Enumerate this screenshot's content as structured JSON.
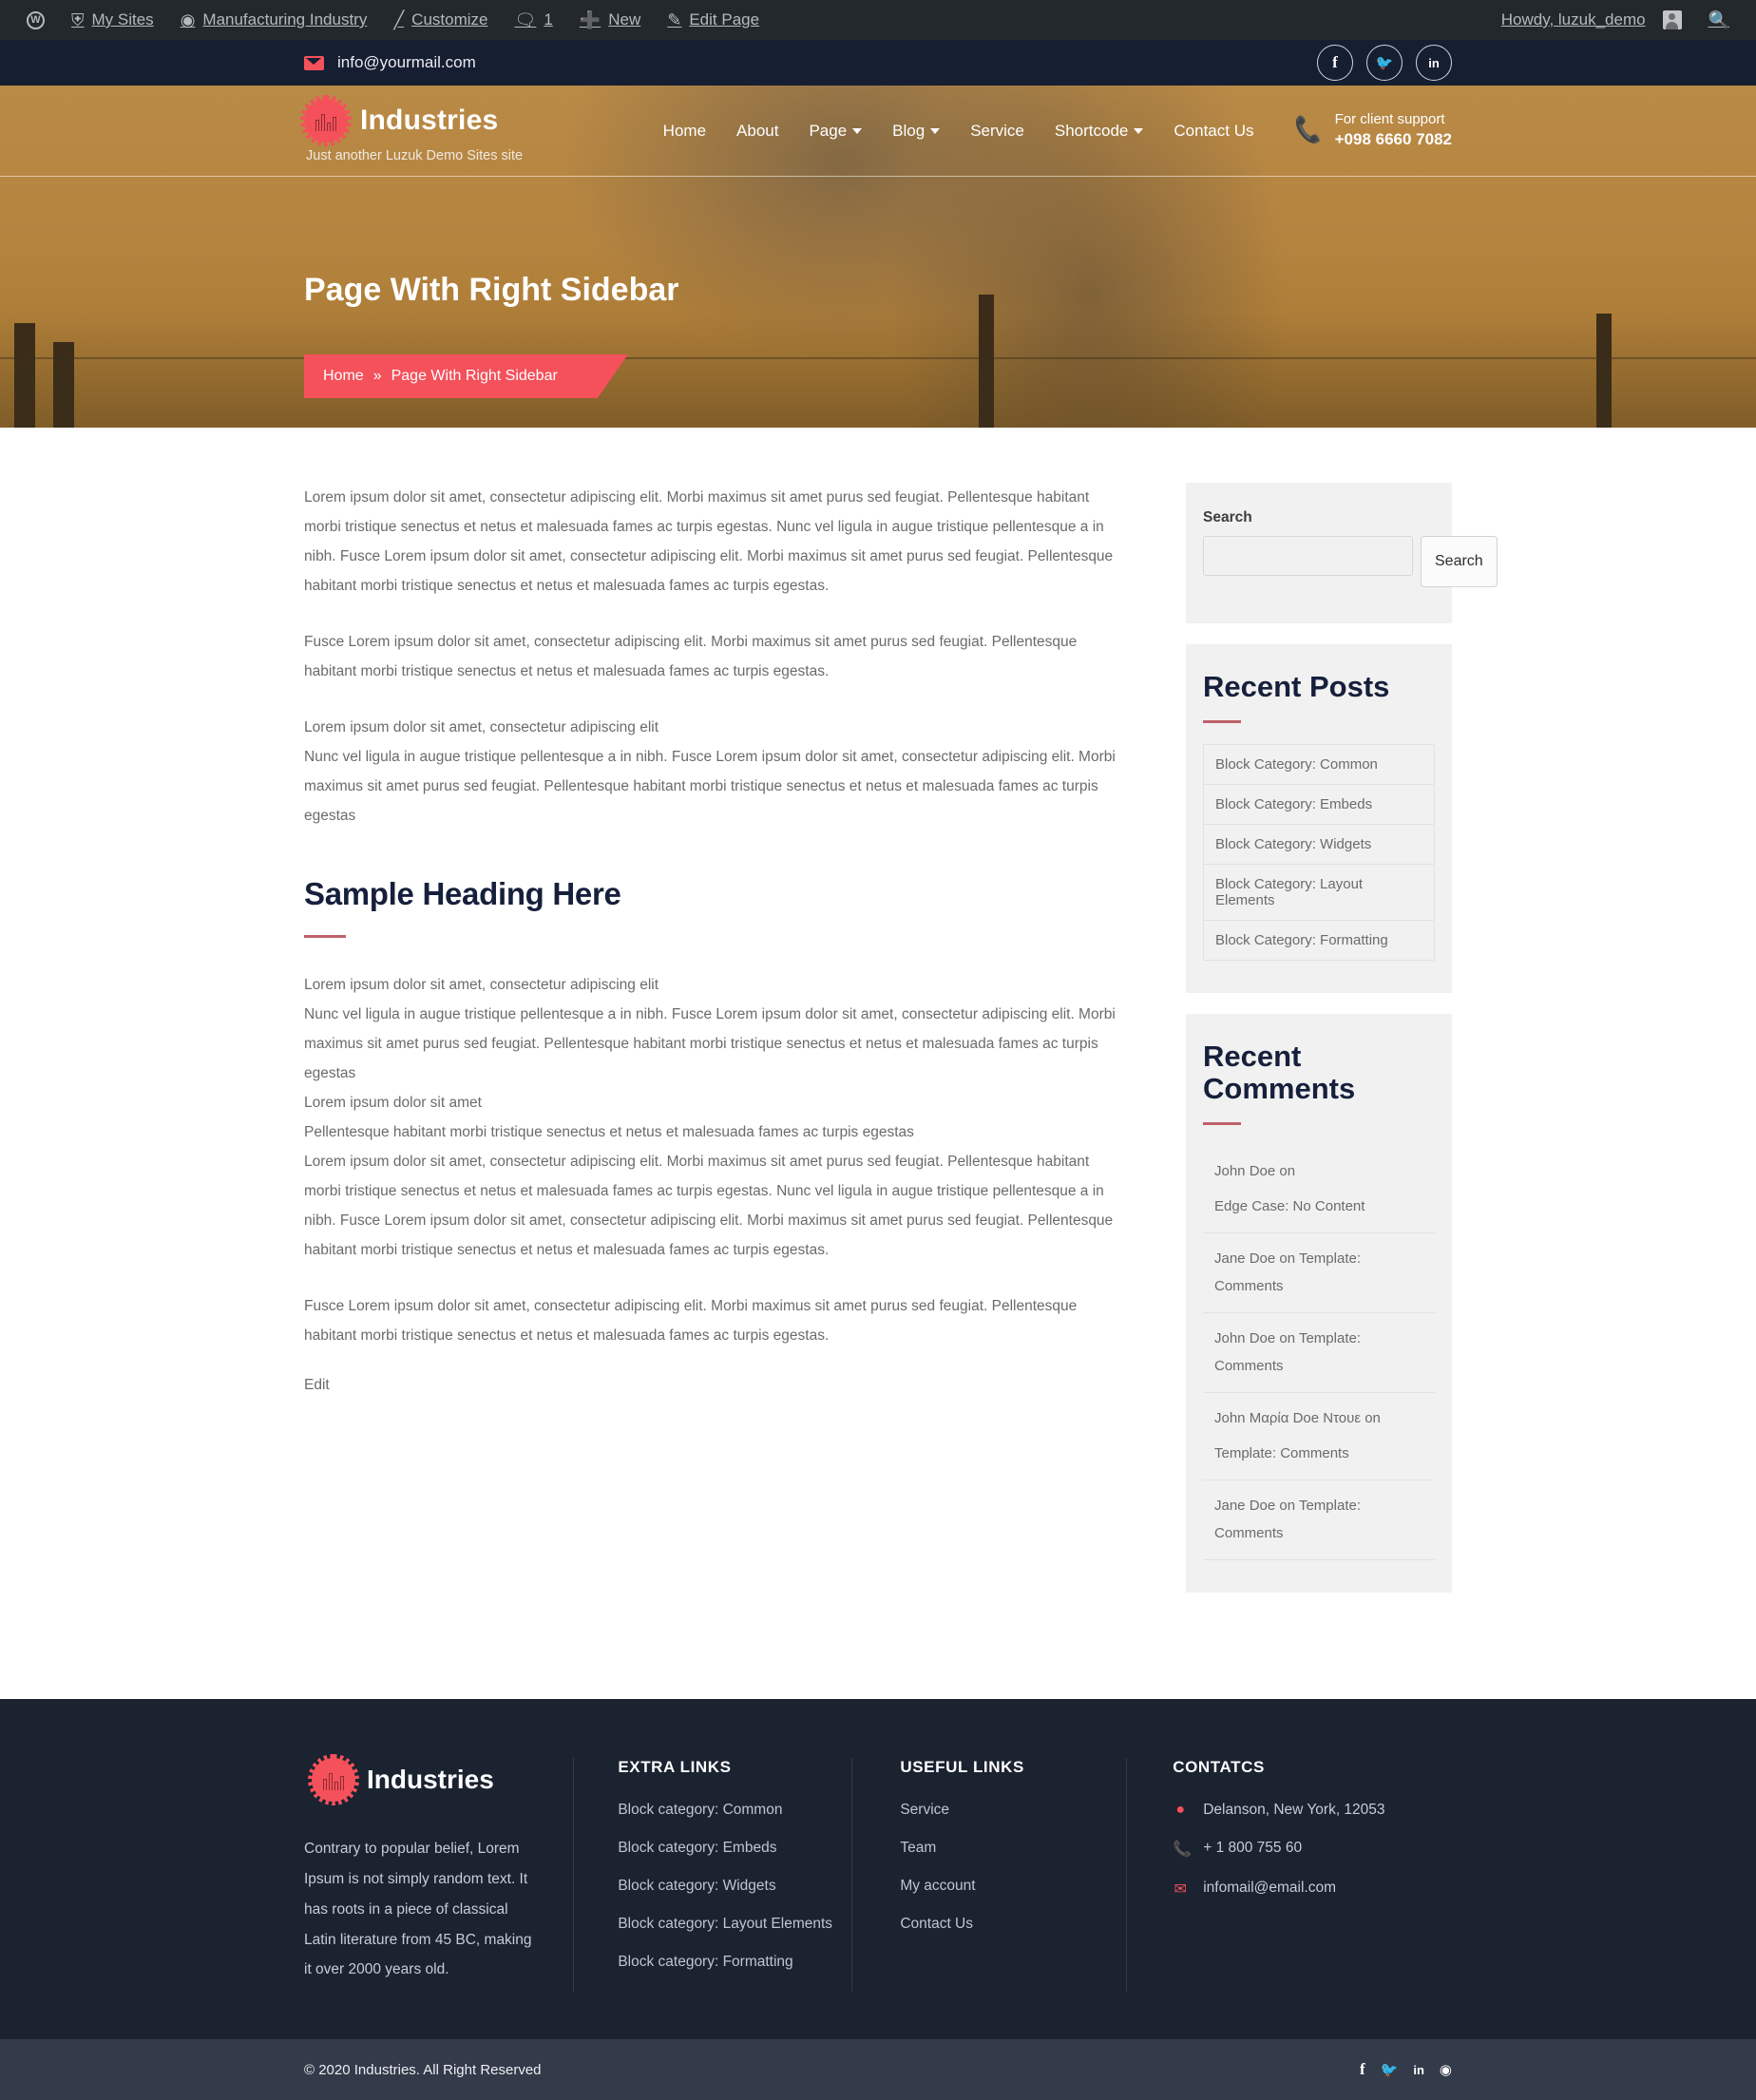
{
  "adminbar": {
    "items": [
      {
        "label": "",
        "icon": "wordpress-icon"
      },
      {
        "label": "My Sites",
        "icon": "sites-icon"
      },
      {
        "label": "Manufacturing Industry",
        "icon": "dashboard-icon"
      },
      {
        "label": "Customize",
        "icon": "brush-icon"
      },
      {
        "label": "1",
        "icon": "comment-icon"
      },
      {
        "label": "New",
        "icon": "plus-icon"
      },
      {
        "label": "Edit Page",
        "icon": "pencil-icon"
      }
    ],
    "howdy": "Howdy, luzuk_demo",
    "search_icon": "search-icon"
  },
  "topbar": {
    "email": "info@yourmail.com",
    "email_icon": "envelope-icon",
    "social": [
      {
        "name": "facebook-icon",
        "glyph": "f"
      },
      {
        "name": "twitter-icon",
        "glyph": "✉"
      },
      {
        "name": "linkedin-icon",
        "glyph": "in"
      }
    ]
  },
  "header": {
    "brand_name": "Industries",
    "tagline": "Just another Luzuk Demo Sites site",
    "nav": [
      {
        "label": "Home",
        "has_dropdown": false
      },
      {
        "label": "About",
        "has_dropdown": false
      },
      {
        "label": "Page",
        "has_dropdown": true
      },
      {
        "label": "Blog",
        "has_dropdown": true
      },
      {
        "label": "Service",
        "has_dropdown": false
      },
      {
        "label": "Shortcode",
        "has_dropdown": true
      },
      {
        "label": "Contact Us",
        "has_dropdown": false
      }
    ],
    "support_label": "For client support",
    "support_phone": "+098 6660 7082"
  },
  "hero": {
    "title": "Page With Right Sidebar",
    "breadcrumb_home": "Home",
    "breadcrumb_sep": "»",
    "breadcrumb_current": "Page With Right Sidebar"
  },
  "content": {
    "p1": "Lorem ipsum dolor sit amet, consectetur adipiscing elit. Morbi maximus sit amet purus sed feugiat. Pellentesque habitant morbi tristique senectus et netus et malesuada fames ac turpis egestas. Nunc vel ligula in augue tristique pellentesque a in nibh. Fusce Lorem ipsum dolor sit amet, consectetur adipiscing elit. Morbi maximus sit amet purus sed feugiat. Pellentesque habitant morbi tristique senectus et netus et malesuada fames ac turpis egestas.",
    "p2": "Fusce Lorem ipsum dolor sit amet, consectetur adipiscing elit. Morbi maximus sit amet purus sed feugiat. Pellentesque habitant morbi tristique senectus et netus et malesuada fames ac turpis egestas.",
    "p3_line1": "Lorem ipsum dolor sit amet, consectetur adipiscing elit",
    "p3_line2": "Nunc vel ligula in augue tristique pellentesque a in nibh. Fusce Lorem ipsum dolor sit amet, consectetur adipiscing elit. Morbi maximus sit amet purus sed feugiat. Pellentesque habitant morbi tristique senectus et netus et malesuada fames ac turpis egestas",
    "heading": "Sample Heading Here",
    "p4_line1": "Lorem ipsum dolor sit amet, consectetur adipiscing elit",
    "p4_line2": "Nunc vel ligula in augue tristique pellentesque a in nibh. Fusce Lorem ipsum dolor sit amet, consectetur adipiscing elit. Morbi maximus sit amet purus sed feugiat. Pellentesque habitant morbi tristique senectus et netus et malesuada fames ac turpis egestas",
    "p4_line3": "Lorem ipsum dolor sit amet",
    "p4_line4": "Pellentesque habitant morbi tristique senectus et netus et malesuada fames ac turpis egestas",
    "p4_line5": "Lorem ipsum dolor sit amet, consectetur adipiscing elit. Morbi maximus sit amet purus sed feugiat. Pellentesque habitant morbi tristique senectus et netus et malesuada fames ac turpis egestas. Nunc vel ligula in augue tristique pellentesque a in nibh. Fusce Lorem ipsum dolor sit amet, consectetur adipiscing elit. Morbi maximus sit amet purus sed feugiat. Pellentesque habitant morbi tristique senectus et netus et malesuada fames ac turpis egestas.",
    "p5": "Fusce Lorem ipsum dolor sit amet, consectetur adipiscing elit. Morbi maximus sit amet purus sed feugiat. Pellentesque habitant morbi tristique senectus et netus et malesuada fames ac turpis egestas.",
    "edit_link": "Edit"
  },
  "sidebar": {
    "search": {
      "label": "Search",
      "value": "",
      "placeholder": "",
      "button": "Search"
    },
    "recent_posts": {
      "title": "Recent Posts",
      "items": [
        "Block Category: Common",
        "Block Category: Embeds",
        "Block Category: Widgets",
        "Block Category: Layout Elements",
        "Block Category: Formatting"
      ]
    },
    "recent_comments": {
      "title": "Recent Comments",
      "items": [
        "John Doe on",
        "Edge Case: No Content",
        "Jane Doe on Template: Comments",
        "John Doe on Template: Comments",
        "John Μαρία Doe Ντουε on",
        "Template: Comments",
        "Jane Doe on Template: Comments"
      ]
    }
  },
  "footer": {
    "brand_name": "Industries",
    "about": "Contrary to popular belief, Lorem Ipsum is not simply random text. It has roots in a piece of classical Latin literature from 45 BC, making it over 2000 years old.",
    "extra_links": {
      "title": "EXTRA LINKS",
      "items": [
        "Block category: Common",
        "Block category: Embeds",
        "Block category: Widgets",
        "Block category: Layout Elements",
        "Block category: Formatting"
      ]
    },
    "useful_links": {
      "title": "USEFUL LINKS",
      "items": [
        "Service",
        "Team",
        "My account",
        "Contact Us"
      ]
    },
    "contacts": {
      "title": "CONTATCS",
      "address": "Delanson, New York, 12053",
      "phone": "+ 1 800 755 60",
      "email": "infomail@email.com"
    },
    "copyright": "© 2020 Industries. All Right Reserved",
    "social": [
      {
        "name": "facebook-icon",
        "glyph": "f"
      },
      {
        "name": "twitter-icon",
        "glyph": "✉"
      },
      {
        "name": "linkedin-icon",
        "glyph": "in"
      },
      {
        "name": "instagram-icon",
        "glyph": "◎"
      }
    ]
  },
  "colors": {
    "accent": "#f4515b",
    "dark": "#1b2230",
    "adminbar": "#23282d",
    "topbar": "#161e32",
    "hero": "#b5843f"
  }
}
